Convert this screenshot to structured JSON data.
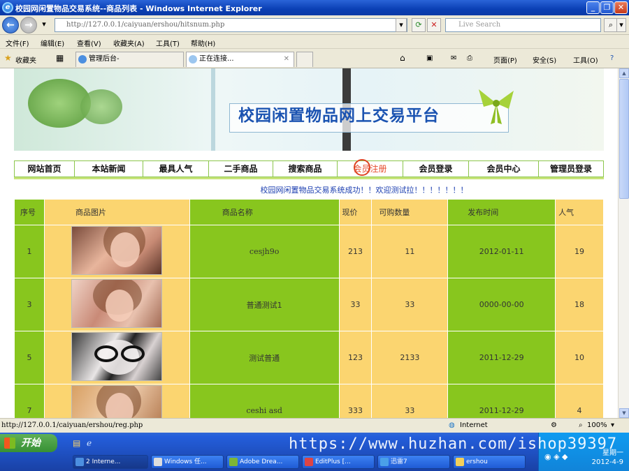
{
  "window": {
    "title": "校园网闲置物品交易系统--商品列表 - Windows Internet Explorer"
  },
  "address": {
    "url": "http://127.0.0.1/caiyuan/ershou/hitsnum.php",
    "search_placeholder": "Live Search"
  },
  "menu": [
    "文件(F)",
    "编辑(E)",
    "查看(V)",
    "收藏夹(A)",
    "工具(T)",
    "帮助(H)"
  ],
  "tabs": {
    "favorites": "收藏夹",
    "items": [
      {
        "label": "管理后台-",
        "active": false
      },
      {
        "label": "正在连接...",
        "active": true
      }
    ],
    "toolbar": {
      "page": "页面(P)",
      "safety": "安全(S)",
      "tools": "工具(O)"
    }
  },
  "site": {
    "banner_title": "校园闲置物品网上交易平台",
    "nav": [
      "网站首页",
      "本站新闻",
      "最具人气",
      "二手商品",
      "搜索商品",
      "会员注册",
      "会员登录",
      "会员中心",
      "管理员登录"
    ],
    "welcome": "校园网闲置物品交易系统成功！！欢迎测试拉！！！！！！！"
  },
  "table": {
    "headers": [
      "序号",
      "商品图片",
      "商品名称",
      "现价",
      "可购数量",
      "发布时间",
      "人气"
    ],
    "rows": [
      {
        "id": "1",
        "name": "cesjh9o",
        "price": "213",
        "qty": "11",
        "date": "2012-01-11",
        "hits": "19"
      },
      {
        "id": "3",
        "name": "普通测试1",
        "price": "33",
        "qty": "33",
        "date": "0000-00-00",
        "hits": "18"
      },
      {
        "id": "5",
        "name": "测试普通",
        "price": "123",
        "qty": "2133",
        "date": "2011-12-29",
        "hits": "10"
      },
      {
        "id": "7",
        "name": "ceshi asd",
        "price": "333",
        "qty": "33",
        "date": "2011-12-29",
        "hits": "4"
      }
    ]
  },
  "status": {
    "url": "http://127.0.0.1/caiyuan/ershou/reg.php",
    "zone": "Internet",
    "zoom": "100%"
  },
  "taskbar": {
    "start": "开始",
    "tasks": [
      "2 Interne...",
      "Windows 任...",
      "Adobe Drea...",
      "EditPlus [...",
      "迅雷7",
      "ershou"
    ],
    "day": "星期一",
    "date": "2012-4-9",
    "watermark": "https://www.huzhan.com/ishop39397"
  },
  "colors": {
    "green": "#88c61e",
    "yellow": "#fbd570",
    "titlebar": "#0a3fb4"
  }
}
